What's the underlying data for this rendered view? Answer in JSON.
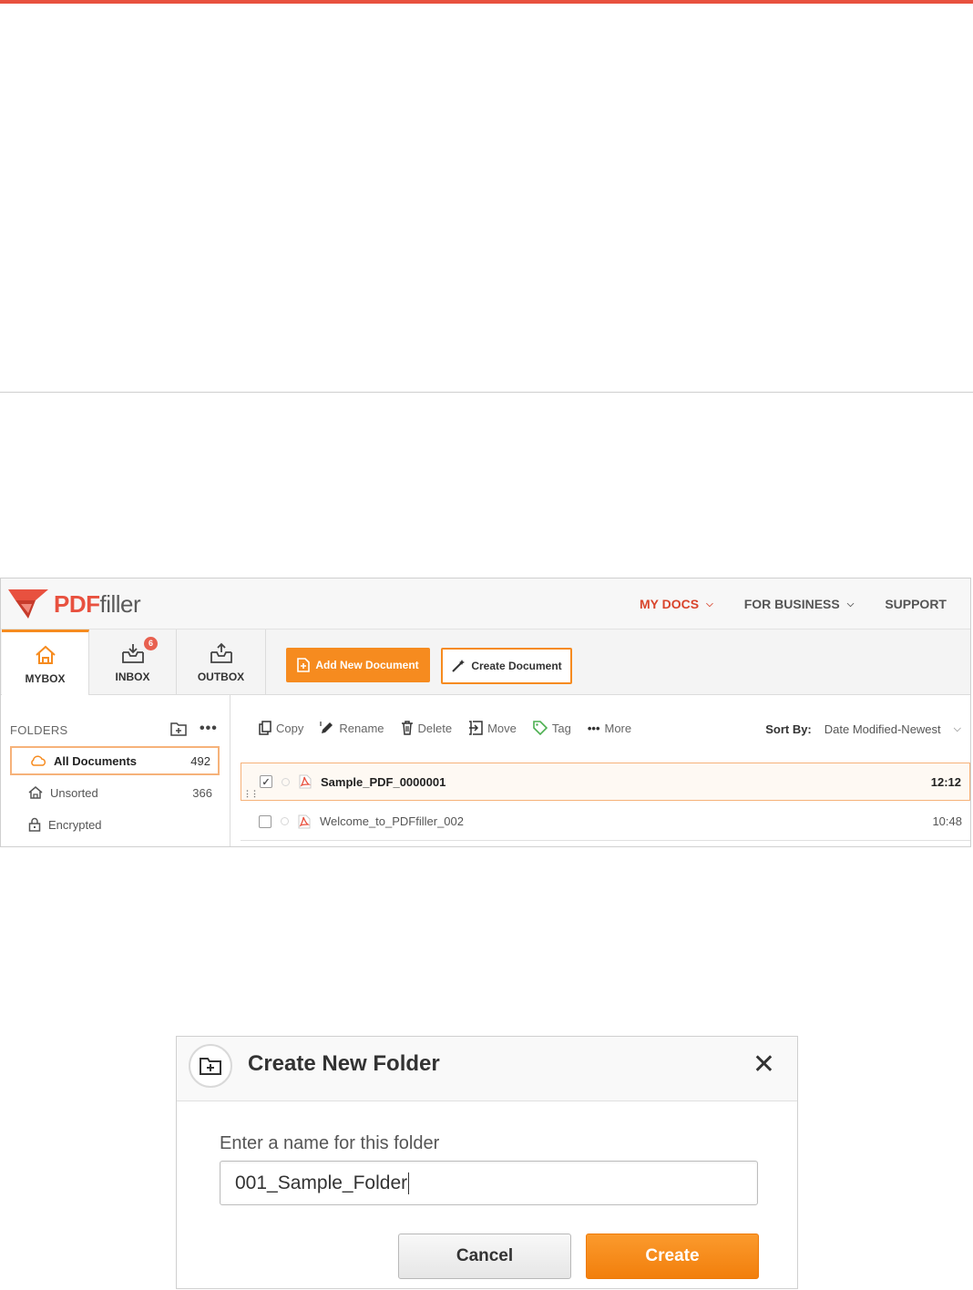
{
  "app": {
    "logo": {
      "pdf": "PDF",
      "filler": "filler"
    },
    "topnav": [
      {
        "label": "MY DOCS",
        "chevron": "chevron-down-icon"
      },
      {
        "label": "FOR BUSINESS",
        "chevron": "chevron-down-icon"
      },
      {
        "label": "SUPPORT"
      }
    ],
    "tabs": [
      {
        "label": "MYBOX",
        "icon": "home-icon"
      },
      {
        "label": "INBOX",
        "icon": "inbox-icon",
        "badge": "6"
      },
      {
        "label": "OUTBOX",
        "icon": "outbox-icon"
      }
    ],
    "buttons": {
      "add_new": "Add New Document",
      "create_doc": "Create Document"
    },
    "folders": {
      "title": "FOLDERS",
      "items": [
        {
          "label": "All Documents",
          "count": "492",
          "icon": "cloud-icon"
        },
        {
          "label": "Unsorted",
          "count": "366",
          "icon": "house-icon"
        },
        {
          "label": "Encrypted",
          "count": "",
          "icon": "lock-icon"
        }
      ]
    },
    "toolbar": {
      "copy": "Copy",
      "rename": "Rename",
      "delete": "Delete",
      "move": "Move",
      "tag": "Tag",
      "more": "More"
    },
    "sort": {
      "label": "Sort By:",
      "value": "Date Modified-Newest"
    },
    "documents": [
      {
        "name": "Sample_PDF_0000001",
        "time": "12:12",
        "checked": true
      },
      {
        "name": "Welcome_to_PDFfiller_002",
        "time": "10:48",
        "checked": false
      }
    ]
  },
  "dialog": {
    "title": "Create New Folder",
    "label": "Enter a name for this folder",
    "input_value": "001_Sample_Folder",
    "cancel": "Cancel",
    "create": "Create"
  },
  "colors": {
    "accent": "#f68b1f",
    "brand_red": "#e8513f"
  }
}
